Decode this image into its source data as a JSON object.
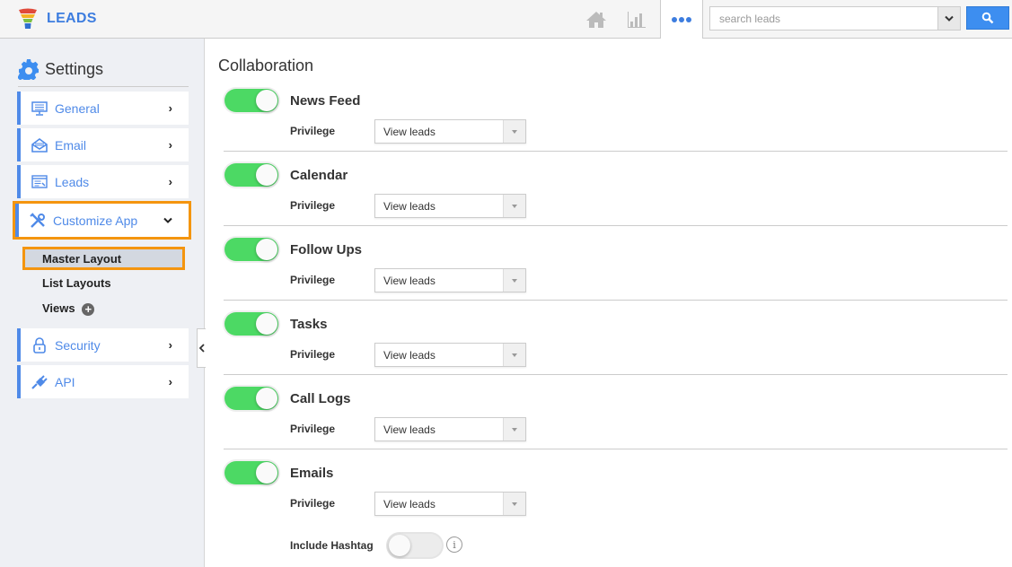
{
  "app": {
    "title": "LEADS"
  },
  "topbar": {
    "icons": [
      "home-icon",
      "chart-icon",
      "more-icon"
    ],
    "search": {
      "placeholder": "search leads",
      "value": ""
    },
    "search_button_icon": "search-icon"
  },
  "sidebar": {
    "title": "Settings",
    "title_icon": "gear-icon",
    "items": [
      {
        "label": "General",
        "icon": "monitor-icon",
        "chevron": "›"
      },
      {
        "label": "Email",
        "icon": "envelope-icon",
        "chevron": "›"
      },
      {
        "label": "Leads",
        "icon": "window-icon",
        "chevron": "›"
      },
      {
        "label": "Customize App",
        "icon": "tools-icon",
        "chevron": "⌄",
        "expanded": true
      },
      {
        "label": "Security",
        "icon": "lock-icon",
        "chevron": "›"
      },
      {
        "label": "API",
        "icon": "plug-icon",
        "chevron": "›"
      }
    ],
    "subitems": [
      {
        "label": "Master Layout",
        "active": true
      },
      {
        "label": "List Layouts"
      },
      {
        "label": "Views",
        "has_add": true,
        "add_symbol": "+"
      }
    ],
    "collapse_symbol": "‹"
  },
  "main": {
    "title": "Collaboration",
    "privilege_label": "Privilege",
    "sections": [
      {
        "name": "News Feed",
        "enabled": true,
        "privilege": "View leads"
      },
      {
        "name": "Calendar",
        "enabled": true,
        "privilege": "View leads"
      },
      {
        "name": "Follow Ups",
        "enabled": true,
        "privilege": "View leads"
      },
      {
        "name": "Tasks",
        "enabled": true,
        "privilege": "View leads"
      },
      {
        "name": "Call Logs",
        "enabled": true,
        "privilege": "View leads"
      },
      {
        "name": "Emails",
        "enabled": true,
        "privilege": "View leads"
      }
    ],
    "include_hashtag": {
      "label": "Include Hashtag",
      "enabled": false,
      "info_symbol": "i"
    }
  },
  "colors": {
    "brand_blue": "#3d7ddf",
    "toggle_on": "#4cd964",
    "highlight_orange": "#f4950f",
    "search_button": "#3d8ef0"
  }
}
